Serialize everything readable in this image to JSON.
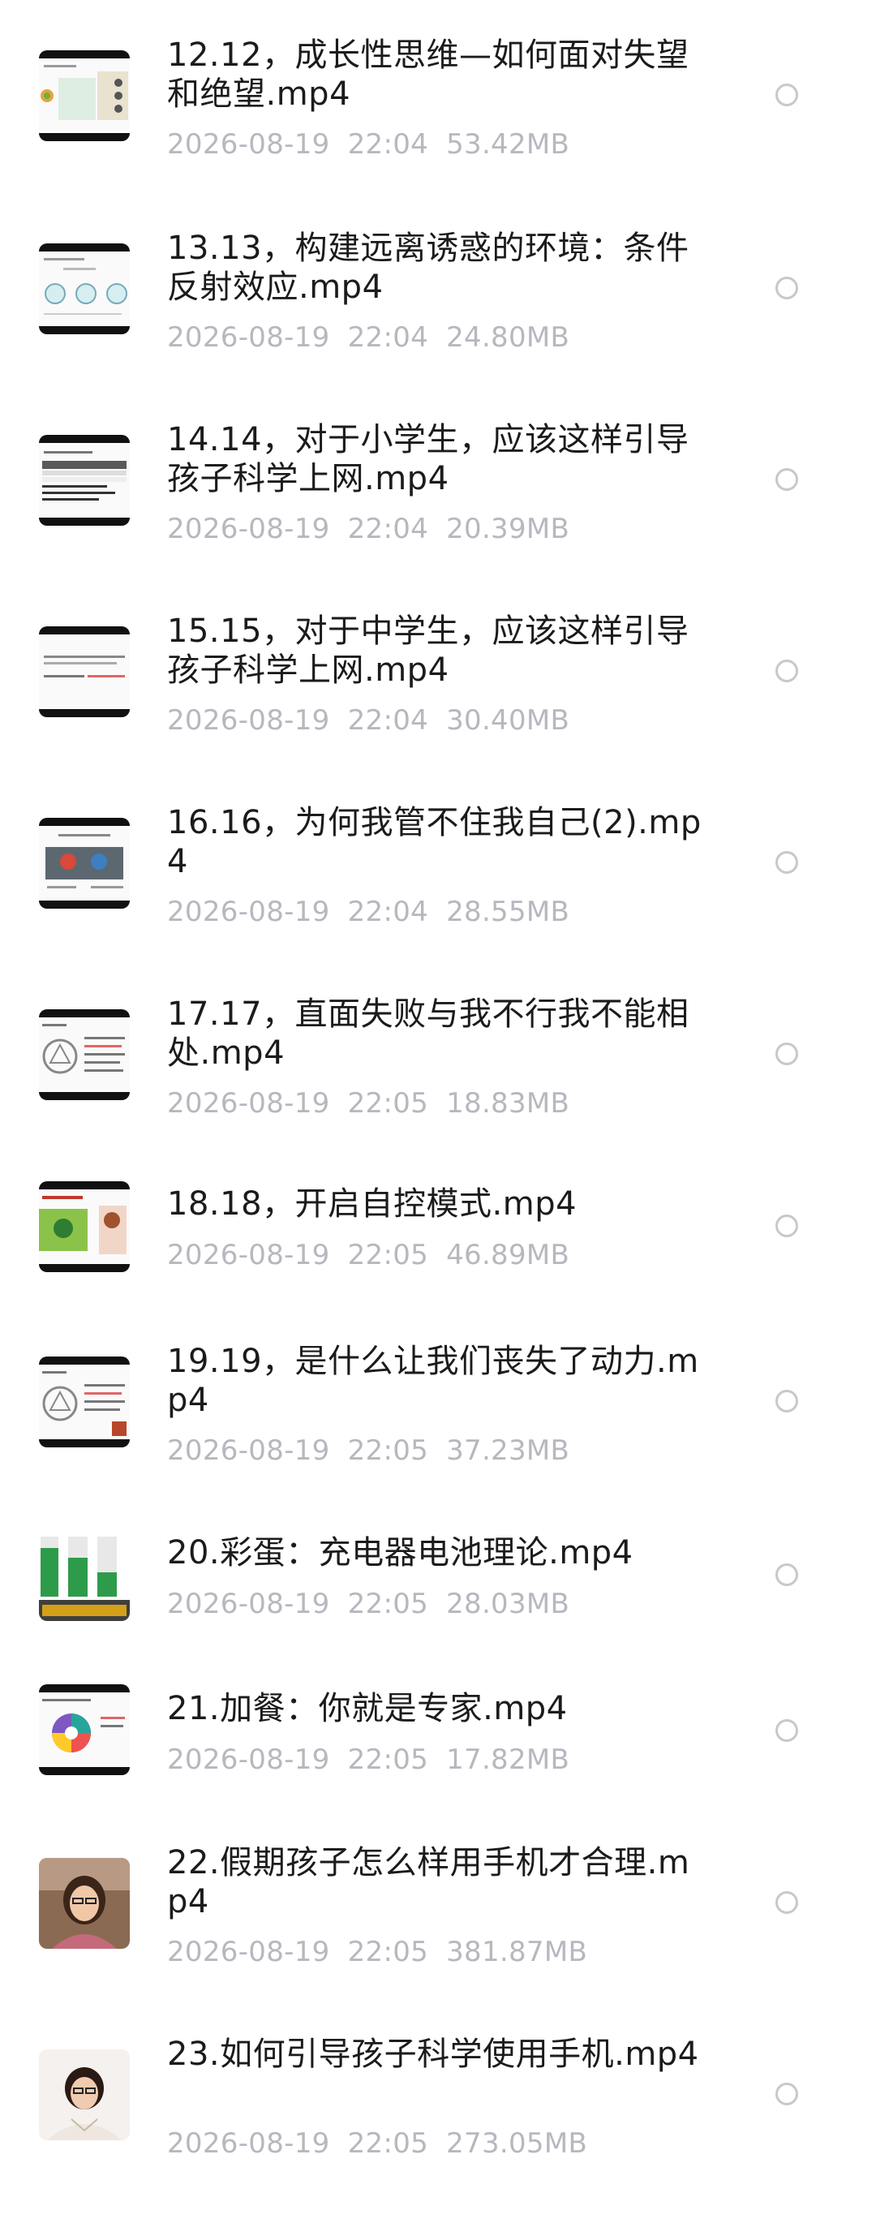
{
  "files": [
    {
      "name": "12.12，成长性思维—如何面对失望和绝望.mp4",
      "date": "2026-08-19",
      "time": "22:04",
      "size": "53.42MB",
      "thumb": "slide-chart"
    },
    {
      "name": "13.13，构建远离诱惑的环境：条件反射效应.mp4",
      "date": "2026-08-19",
      "time": "22:04",
      "size": "24.80MB",
      "thumb": "slide-circles"
    },
    {
      "name": "14.14，对于小学生，应该这样引导孩子科学上网.mp4",
      "date": "2026-08-19",
      "time": "22:04",
      "size": "20.39MB",
      "thumb": "slide-table"
    },
    {
      "name": "15.15，对于中学生，应该这样引导孩子科学上网.mp4",
      "date": "2026-08-19",
      "time": "22:04",
      "size": "30.40MB",
      "thumb": "slide-text"
    },
    {
      "name": "16.16，为何我管不住我自己(2).mp4",
      "date": "2026-08-19",
      "time": "22:04",
      "size": "28.55MB",
      "thumb": "slide-figures"
    },
    {
      "name": "17.17，直面失败与我不行我不能相处.mp4",
      "date": "2026-08-19",
      "time": "22:05",
      "size": "18.83MB",
      "thumb": "slide-cycle"
    },
    {
      "name": "18.18，开启自控模式.mp4",
      "date": "2026-08-19",
      "time": "22:05",
      "size": "46.89MB",
      "thumb": "slide-green"
    },
    {
      "name": "19.19，是什么让我们丧失了动力.mp4",
      "date": "2026-08-19",
      "time": "22:05",
      "size": "37.23MB",
      "thumb": "slide-cycle"
    },
    {
      "name": "20.彩蛋：充电器电池理论.mp4",
      "date": "2026-08-19",
      "time": "22:05",
      "size": "28.03MB",
      "thumb": "slide-battery"
    },
    {
      "name": "21.加餐：你就是专家.mp4",
      "date": "2026-08-19",
      "time": "22:05",
      "size": "17.82MB",
      "thumb": "slide-wheel"
    },
    {
      "name": "22.假期孩子怎么样用手机才合理.mp4",
      "date": "2026-08-19",
      "time": "22:05",
      "size": "381.87MB",
      "thumb": "photo-woman"
    },
    {
      "name": "23.如何引导孩子科学使用手机.mp4",
      "date": "2026-08-19",
      "time": "22:05",
      "size": "273.05MB",
      "thumb": "photo-woman"
    }
  ]
}
